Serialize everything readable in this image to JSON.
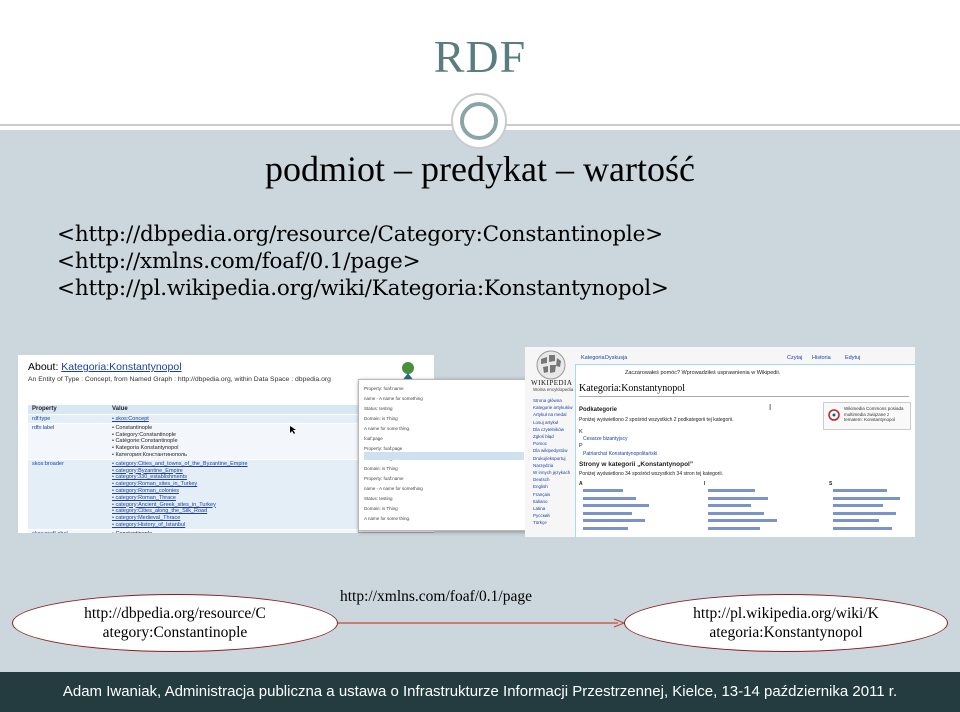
{
  "slide": {
    "title": "RDF",
    "subtitle_parts": [
      "podmiot",
      "–",
      "predykat",
      "–",
      "wartość"
    ],
    "subtitle": "podmiot – predykat – wartość",
    "uri_subject": "<http://dbpedia.org/resource/Category:Constantinople>",
    "uri_predicate": "<http://xmlns.com/foaf/0.1/page>",
    "uri_object": "<http://pl.wikipedia.org/wiki/Kategoria:Konstantynopol>"
  },
  "dbpedia_shot": {
    "about_label": "About:",
    "about_value": "Kategoria:Konstantynopol",
    "entity_line": "An Entity of Type : Concept, from Named Graph : http://dbpedia.org, within Data Space : dbpedia.org",
    "col_property": "Property",
    "col_value": "Value",
    "rows": [
      {
        "prop": "rdf:type",
        "values": [
          "skos:Concept"
        ]
      },
      {
        "prop": "rdfs:label",
        "values": [
          "Constantinople",
          "Category:Constantinople",
          "Catégorie:Constantinople",
          "Kategoria Konstantynopol",
          "Категория:Константинополь"
        ]
      },
      {
        "prop": "skos:broader",
        "values": [
          "category:Cities_and_towns_of_the_Byzantine_Empire",
          "category:Byzantine_Empire",
          "category:330_establishments",
          "category:Roman_sites_in_Turkey",
          "category:Roman_colonies",
          "category:Roman_Thrace",
          "category:Ancient_Greek_sites_in_Turkey",
          "category:Cities_along_the_Silk_Road",
          "category:Medieval_Thrace",
          "category:History_of_Istanbul"
        ]
      },
      {
        "prop": "skos:prefLabel",
        "values": [
          "Constantinople"
        ]
      }
    ],
    "popup_lines": [
      "Property: foaf:name",
      "name - A name for something",
      "Status: testing",
      "Domain: is Thing",
      "A name for some thing.",
      "foaf:page",
      "Property: foaf:page",
      "Status: testing",
      "Domain: is Thing"
    ]
  },
  "wikipedia_shot": {
    "logo_text": "WIKIPEDIA",
    "logo_sub": "Wolna encyklopedia",
    "tabs": [
      "Kategoria",
      "Dyskusja"
    ],
    "right_tabs": [
      "Czytaj",
      "Historia",
      "Edytuj"
    ],
    "notice": "Zaczarowałeś pomóc? Wprowadziłeś usprawnienia w Wikipedii.",
    "page_title": "Kategoria:Konstantynopol",
    "side_links": [
      "Strona główna",
      "Kategorie artykułów",
      "Artykuł na medal",
      "Losuj artykuł",
      "Dla czytelników",
      "Zgłoś błąd",
      "Pomoc",
      "Dla wikipedystów",
      "Drukuj/eksportuj",
      "Narzędzia",
      "W innych językach"
    ],
    "lang_links": [
      "Deutsch",
      "English",
      "Français",
      "Italiano",
      "Latina",
      "Русский",
      "Türkçe"
    ],
    "subcat_header": "Podkategorie",
    "subcat_info": "Poniżej wyświetlono 2 spośród wszystkich 2 podkategorii tej kategorii.",
    "subcats": [
      "Cesarze bizantyjscy",
      "Patriarchat Konstantynopolitański"
    ],
    "pages_header": "Strony w kategorii „Konstantynopol”",
    "pages_info": "Poniżej wyświetlono 34 spośród wszystkich 34 stron tej kategorii.",
    "commons_text": "Wikimedia Commons posiada multimedia związane z tematem: Konstantynopol"
  },
  "diagram": {
    "subject": "http://dbpedia.org/resource/Category:Constantinople",
    "subject_lines": [
      "http://dbpedia.org/resource/C",
      "ategory:Constantinople"
    ],
    "predicate": "http://xmlns.com/foaf/0.1/page",
    "object": "http://pl.wikipedia.org/wiki/Kategoria:Konstantynopol",
    "object_lines": [
      "http://pl.wikipedia.org/wiki/K",
      "ategoria:Konstantynopol"
    ]
  },
  "footer": {
    "text": "Adam Iwaniak,  Administracja publiczna a ustawa o Infrastrukturze Informacji Przestrzennej,  Kielce,  13-14 października 2011 r."
  },
  "colors": {
    "title": "#5a7d80",
    "content_bg": "#ccd7dd",
    "footer_bg": "#243c40",
    "ellipse_border": "#8a1d1d",
    "arrow": "#c04a3a"
  }
}
